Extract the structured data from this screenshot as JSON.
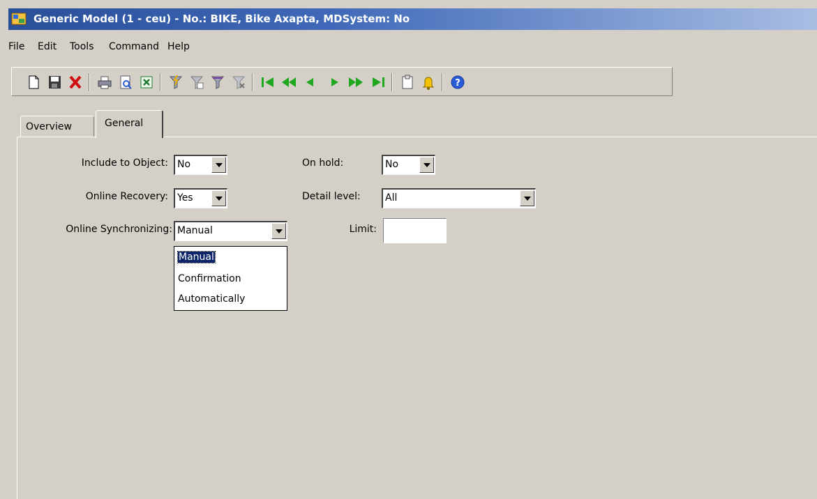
{
  "window": {
    "title": "Generic Model (1 - ceu) - No.: BIKE, Bike Axapta, MDSystem: No"
  },
  "menu": [
    "File",
    "Edit",
    "Tools",
    "Command",
    "Help"
  ],
  "toolbar_icons": [
    "new-icon",
    "save-icon",
    "delete-icon",
    "print-icon",
    "print-preview-icon",
    "export-excel-icon",
    "filter-by-selection-icon",
    "filter-by-grid-icon",
    "advanced-filter-icon",
    "remove-filter-icon",
    "first-record-icon",
    "previous-page-icon",
    "previous-record-icon",
    "next-record-icon",
    "next-page-icon",
    "last-record-icon",
    "document-handling-icon",
    "alert-icon",
    "help-icon"
  ],
  "tabs": {
    "overview": "Overview",
    "general": "General",
    "active": "General"
  },
  "fields": {
    "include_to_object": {
      "label": "Include to Object:",
      "value": "No"
    },
    "online_recovery": {
      "label": "Online Recovery:",
      "value": "Yes"
    },
    "online_synchronizing": {
      "label": "Online Synchronizing:",
      "value": "Manual",
      "options": [
        "Manual",
        "Confirmation",
        "Automatically"
      ]
    },
    "on_hold": {
      "label": "On hold:",
      "value": "No"
    },
    "detail_level": {
      "label": "Detail level:",
      "value": "All"
    },
    "limit": {
      "label": "Limit:",
      "value": ""
    }
  },
  "colors": {
    "title_bar": "#2a4f99",
    "window_bg": "#d4d0c8",
    "selection": "#0a246a"
  }
}
